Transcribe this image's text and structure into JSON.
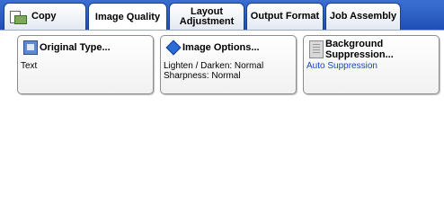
{
  "tabs": [
    {
      "label": "Copy"
    },
    {
      "label": "Image Quality"
    },
    {
      "label_line1": "Layout",
      "label_line2": "Adjustment"
    },
    {
      "label": "Output Format"
    },
    {
      "label": "Job Assembly"
    }
  ],
  "buttons": {
    "original_type": {
      "title": "Original Type...",
      "value": "Text"
    },
    "image_options": {
      "title": "Image Options...",
      "value_line1": "Lighten / Darken: Normal",
      "value_line2": "Sharpness: Normal"
    },
    "background_suppression": {
      "title_line1": "Background",
      "title_line2": "Suppression...",
      "value": "Auto Suppression"
    }
  },
  "colors": {
    "tabbar": "#1f4fb5",
    "value_blue": "#1144cc"
  },
  "icons": [
    "copy-icon",
    "original-type-icon",
    "image-options-icon",
    "background-suppression-icon"
  ]
}
